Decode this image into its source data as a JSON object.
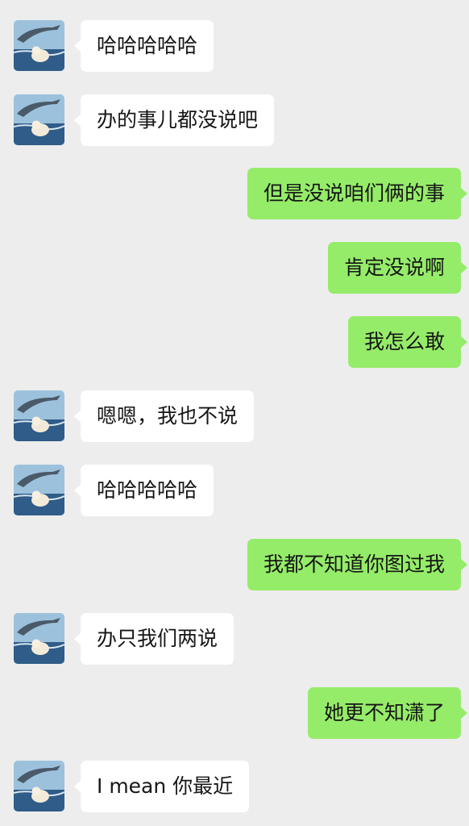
{
  "chat": {
    "messages": [
      {
        "side": "in",
        "text": "哈哈哈哈哈"
      },
      {
        "side": "in",
        "text": "办的事儿都没说吧"
      },
      {
        "side": "out",
        "text": "但是没说咱们俩的事"
      },
      {
        "side": "out",
        "text": "肯定没说啊"
      },
      {
        "side": "out",
        "text": "我怎么敢"
      },
      {
        "side": "in",
        "text": "嗯嗯，我也不说"
      },
      {
        "side": "in",
        "text": "哈哈哈哈哈"
      },
      {
        "side": "out",
        "text": "我都不知道你图过我"
      },
      {
        "side": "in",
        "text": "办只我们两说"
      },
      {
        "side": "out",
        "text": "她更不知潇了"
      },
      {
        "side": "in",
        "text": "I mean 你最近"
      }
    ]
  },
  "avatar_icon": "dolphin-avatar-icon",
  "colors": {
    "background": "#ededed",
    "incoming_bubble": "#ffffff",
    "outgoing_bubble": "#95ec69",
    "text": "#161616"
  }
}
